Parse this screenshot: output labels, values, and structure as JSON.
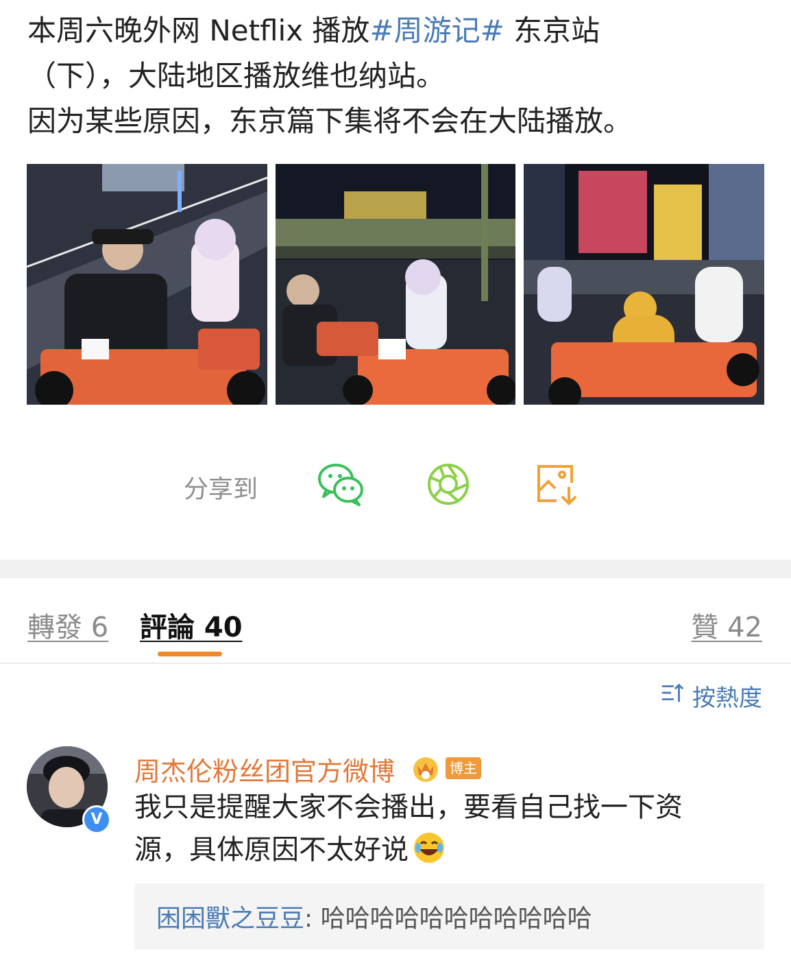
{
  "post": {
    "line1_text": "本周六晚外网 Netflix 播放",
    "line1_hashtag": "#周游记#",
    "line1_tail": " 东京站",
    "line2": "（下），大陆地区播放维也纳站。",
    "line3": "因为某些原因，东京篇下集将不会在大陆播放。"
  },
  "share": {
    "label": "分享到",
    "icons": [
      "wechat-icon",
      "moments-icon",
      "save-image-icon"
    ]
  },
  "tabs": {
    "repost": "轉發 6",
    "comments": "評論 40",
    "likes": "贊 42"
  },
  "sort": {
    "label": "按熱度"
  },
  "comment": {
    "author": "周杰伦粉丝团官方微博",
    "badge": "博主",
    "verified_mark": "V",
    "line1": "我只是提醒大家不会播出，要看自己找一下资",
    "line2": "源，具体原因不太好说",
    "reply": {
      "author": "困困獸之豆豆",
      "separator": ": ",
      "text": "哈哈哈哈哈哈哈哈哈哈哈"
    }
  },
  "colors": {
    "hashtag": "#4a7bb5",
    "accent": "#f08a29",
    "author": "#e0783a",
    "wechat_green": "#3cbf5b",
    "moments_green": "#8ccf49",
    "save_orange": "#f0a334"
  }
}
